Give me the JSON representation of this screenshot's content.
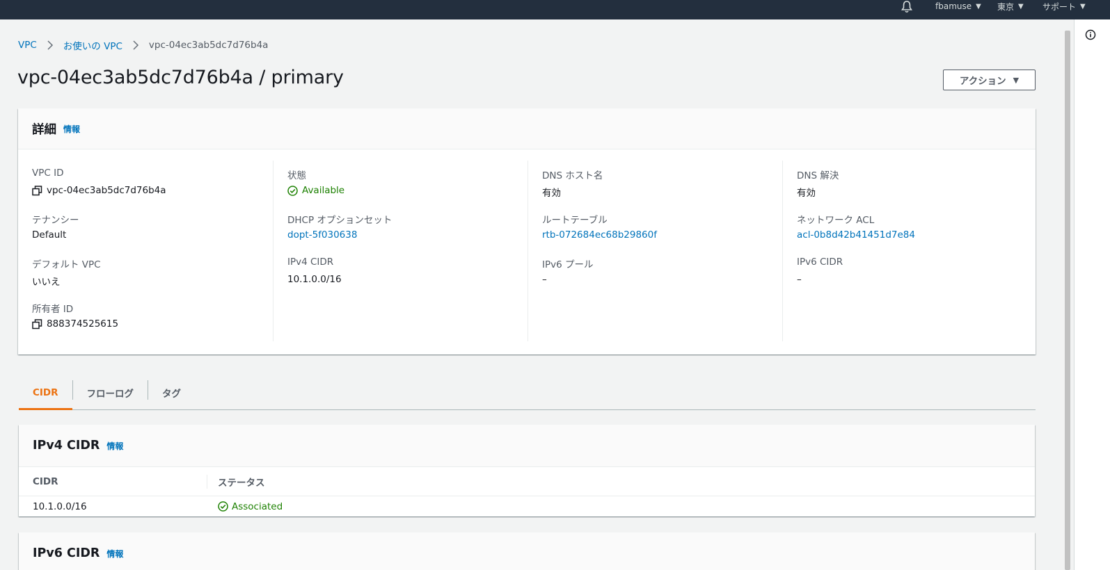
{
  "topnav": {
    "user": "fbamuse",
    "region": "東京",
    "support": "サポート"
  },
  "breadcrumb": {
    "items": [
      "VPC",
      "お使いの VPC"
    ],
    "current": "vpc-04ec3ab5dc7d76b4a"
  },
  "page": {
    "title": "vpc-04ec3ab5dc7d76b4a / primary",
    "action_label": "アクション"
  },
  "details": {
    "title": "詳細",
    "info": "情報",
    "col1": {
      "vpc_id_label": "VPC ID",
      "vpc_id_value": "vpc-04ec3ab5dc7d76b4a",
      "tenancy_label": "テナンシー",
      "tenancy_value": "Default",
      "default_vpc_label": "デフォルト VPC",
      "default_vpc_value": "いいえ",
      "owner_label": "所有者 ID",
      "owner_value": "888374525615"
    },
    "col2": {
      "state_label": "状態",
      "state_value": "Available",
      "dhcp_label": "DHCP オプションセット",
      "dhcp_value": "dopt-5f030638",
      "ipv4_label": "IPv4 CIDR",
      "ipv4_value": "10.1.0.0/16"
    },
    "col3": {
      "dns_host_label": "DNS ホスト名",
      "dns_host_value": "有効",
      "route_label": "ルートテーブル",
      "route_value": "rtb-072684ec68b29860f",
      "ipv6_pool_label": "IPv6 プール",
      "ipv6_pool_value": "–"
    },
    "col4": {
      "dns_res_label": "DNS 解決",
      "dns_res_value": "有効",
      "acl_label": "ネットワーク ACL",
      "acl_value": "acl-0b8d42b41451d7e84",
      "ipv6_cidr_label": "IPv6 CIDR",
      "ipv6_cidr_value": "–"
    }
  },
  "tabs": [
    "CIDR",
    "フローログ",
    "タグ"
  ],
  "ipv4_cidr": {
    "title": "IPv4 CIDR",
    "info": "情報",
    "columns": [
      "CIDR",
      "ステータス"
    ],
    "rows": [
      {
        "cidr": "10.1.0.0/16",
        "status": "Associated"
      }
    ]
  },
  "ipv6_cidr": {
    "title": "IPv6 CIDR",
    "info": "情報"
  },
  "colors": {
    "nav_bg": "#232f3e",
    "link": "#0073bb",
    "success": "#1d8102",
    "active_tab": "#ec7211"
  },
  "icons": [
    "bell-icon",
    "chevron-right-icon",
    "copy-icon",
    "check-circle-icon",
    "info-circle-icon",
    "caret-down-icon"
  ]
}
